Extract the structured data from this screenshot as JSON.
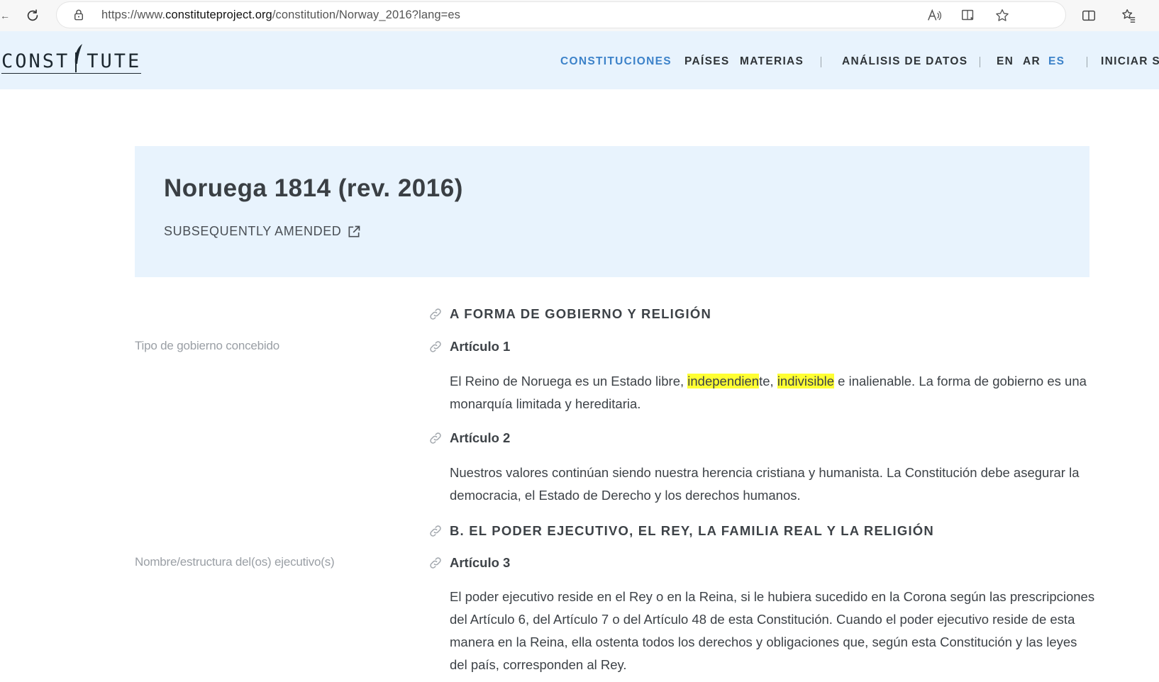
{
  "browser": {
    "url_prefix": "https://www.",
    "url_domain": "constituteproject.org",
    "url_path": "/constitution/Norway_2016?lang=es",
    "edge_glyph": "←"
  },
  "site": {
    "logo_text_left": "CONST",
    "logo_text_right": "TUTE",
    "nav": {
      "constituciones": "CONSTITUCIONES",
      "paises": "PAÍSES",
      "materias": "MATERIAS",
      "analisis": "ANÁLISIS DE DATOS",
      "lang_en": "EN",
      "lang_ar": "AR",
      "lang_es": "ES",
      "login": "INICIAR S"
    },
    "colors": {
      "header_bg": "#e8f3fd",
      "accent": "#3c82c9",
      "highlight": "#ffff33"
    }
  },
  "doc": {
    "title": "Noruega 1814 (rev. 2016)",
    "amended_label": "SUBSEQUENTLY AMENDED",
    "section_a": "A FORMA DE GOBIERNO Y RELIGIÓN",
    "tag_1": "Tipo de gobierno concebido",
    "art1_title": "Artículo 1",
    "art1": {
      "pre": "El Reino de Noruega es un Estado libre, ",
      "hl1": "independien",
      "mid1": "te, ",
      "hl2": "indivisible",
      "post": " e inalienable. La forma de gobierno es una monarquía limitada y hereditaria."
    },
    "art2_title": "Artículo 2",
    "art2_text": "Nuestros valores continúan siendo nuestra herencia cristiana y humanista. La Constitución debe asegurar la democracia, el Estado de Derecho y los derechos humanos.",
    "section_b": "B. EL PODER EJECUTIVO, EL REY, LA FAMILIA REAL Y LA RELIGIÓN",
    "tag_2": "Nombre/estructura del(os) ejecutivo(s)",
    "art3_title": "Artículo 3",
    "art3_text": "El poder ejecutivo reside en el Rey o en la Reina, si le hubiera sucedido en la Corona según las prescripciones del Artículo 6, del Artículo 7 o del Artículo 48 de esta Constitución. Cuando el poder ejecutivo reside de esta manera en la Reina, ella ostenta todos los derechos y obligaciones que, según esta Constitución y las leyes del país, corresponden al Rey."
  }
}
